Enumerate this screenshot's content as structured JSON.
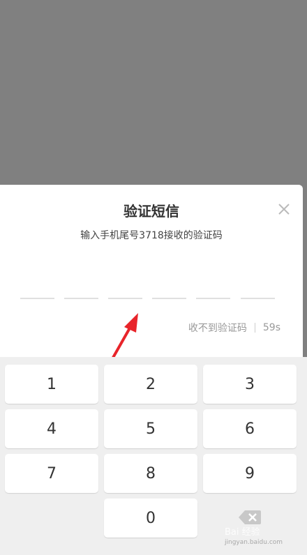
{
  "dialog": {
    "title": "验证短信",
    "subtitle": "输入手机尾号3718接收的验证码",
    "code_boxes": 6,
    "resend_label": "收不到验证码",
    "countdown": "59s"
  },
  "keypad": {
    "keys": [
      "1",
      "2",
      "3",
      "4",
      "5",
      "6",
      "7",
      "8",
      "9",
      "0"
    ]
  },
  "watermark": {
    "text": "Bai 经验",
    "sub": "jingyan.baidu.com"
  },
  "icons": [
    "close-icon",
    "backspace-icon",
    "arrow-annotation"
  ],
  "colors": {
    "overlay": "#808080",
    "annotation": "#e8242a"
  }
}
